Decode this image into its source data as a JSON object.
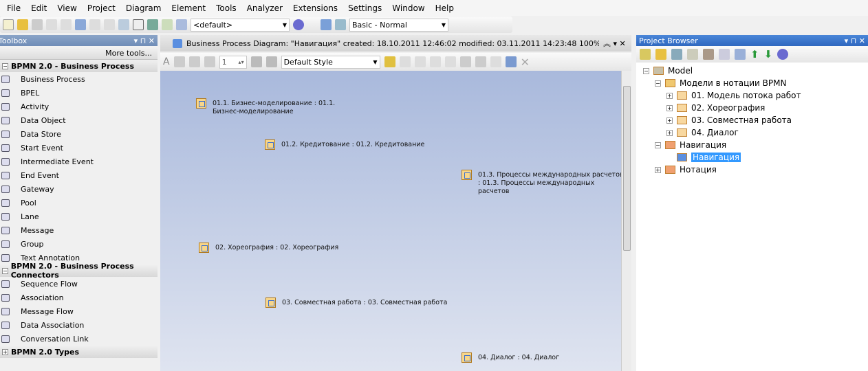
{
  "menu": [
    "File",
    "Edit",
    "View",
    "Project",
    "Diagram",
    "Element",
    "Tools",
    "Analyzer",
    "Extensions",
    "Settings",
    "Window",
    "Help"
  ],
  "toolbar": {
    "perspective": "<default>",
    "workspace": "Basic - Normal"
  },
  "toolbox": {
    "title": "Toolbox",
    "more_tools": "More tools...",
    "groups": [
      {
        "label": "BPMN 2.0 - Business Process",
        "expanded": true,
        "items": [
          "Business Process",
          "BPEL",
          "Activity",
          "Data Object",
          "Data Store",
          "Start Event",
          "Intermediate Event",
          "End Event",
          "Gateway",
          "Pool",
          "Lane",
          "Message",
          "Group",
          "Text Annotation"
        ]
      },
      {
        "label": "BPMN 2.0 - Business Process Connectors",
        "expanded": true,
        "items": [
          "Sequence Flow",
          "Association",
          "Message Flow",
          "Data Association",
          "Conversation Link"
        ]
      },
      {
        "label": "BPMN 2.0 Types",
        "expanded": false,
        "items": []
      }
    ]
  },
  "diagram": {
    "tab_title": "Business Process Diagram: \"Навигация\"   created: 18.10.2011 12:46:02  modified: 03.11.2011 14:23:48   100%   850 x 1",
    "line_width": "1",
    "style": "Default Style",
    "nodes": [
      {
        "label": "01.1. Бизнес-моделирование : 01.1. Бизнес-моделирование"
      },
      {
        "label": "01.2. Кредитование : 01.2. Кредитование"
      },
      {
        "label": "01.3. Процессы международных расчетов : 01.3. Процессы международных расчетов"
      },
      {
        "label": "02. Хореография : 02. Хореография"
      },
      {
        "label": "03. Совместная работа : 03. Совместная работа"
      },
      {
        "label": "04. Диалог : 04. Диалог"
      }
    ]
  },
  "project_browser": {
    "title": "Project Browser",
    "tree": [
      {
        "label": "Model",
        "level": 0,
        "expander": "-"
      },
      {
        "label": "Модели в нотации BPMN",
        "level": 1,
        "expander": "-"
      },
      {
        "label": "01. Модель потока работ",
        "level": 2,
        "expander": "+"
      },
      {
        "label": "02. Хореография",
        "level": 2,
        "expander": "+"
      },
      {
        "label": "03. Совместная работа",
        "level": 2,
        "expander": "+"
      },
      {
        "label": "04. Диалог",
        "level": 2,
        "expander": "+"
      },
      {
        "label": "Навигация",
        "level": 1,
        "expander": "-"
      },
      {
        "label": "Навигация",
        "level": 2,
        "expander": "",
        "selected": true
      },
      {
        "label": "Нотация",
        "level": 1,
        "expander": "+"
      }
    ]
  }
}
